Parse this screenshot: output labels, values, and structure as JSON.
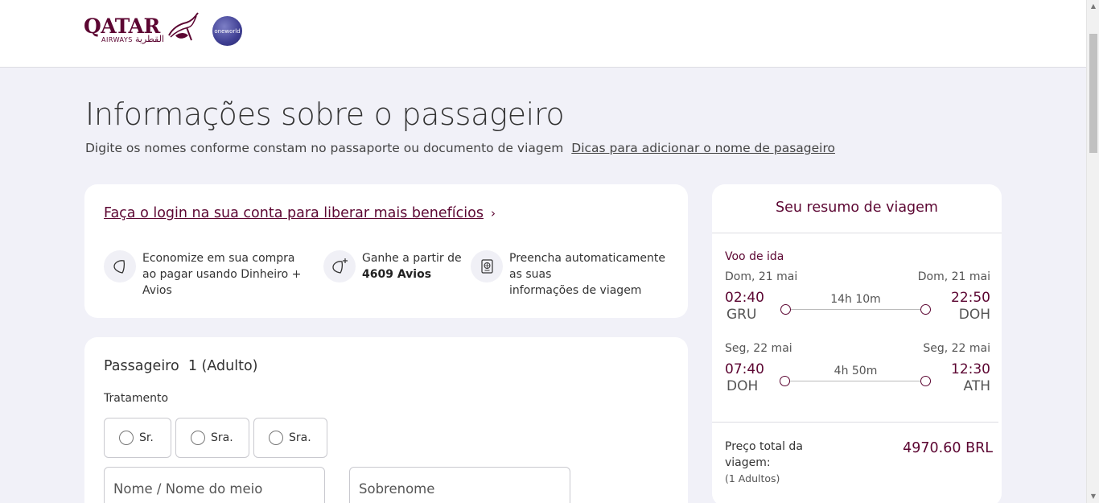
{
  "header": {
    "logo": {
      "wordmark": "QATAR",
      "subtitle": "AIRWAYS",
      "arabic": "القطرية"
    },
    "alliance_logo": "oneworld"
  },
  "page": {
    "title": "Informações sobre o passageiro",
    "subtitle": "Digite os nomes conforme constam no passaporte ou documento de viagem",
    "tips_link": "Dicas para adicionar o nome de pasageiro"
  },
  "login_card": {
    "link_label": "Faça o login na sua conta para liberar mais benefícios",
    "benefits": [
      {
        "icon": "avios-icon",
        "line1": "Economize em sua compra",
        "line2": "ao pagar usando Dinheiro +",
        "line3": "Avios"
      },
      {
        "icon": "avios-plus-icon",
        "line1": "Ganhe a partir de",
        "bold": "4609 Avios"
      },
      {
        "icon": "passport-icon",
        "line1": "Preencha automaticamente",
        "line2": "as suas",
        "line3": "informações de viagem"
      }
    ]
  },
  "passenger": {
    "title": "Passageiro  1 (Adulto)",
    "treatment_label": "Tratamento",
    "options": [
      "Sr.",
      "Sra.",
      "Sra."
    ],
    "first_name_placeholder": "Nome / Nome do meio",
    "last_name_placeholder": "Sobrenome"
  },
  "summary": {
    "title": "Seu resumo de viagem",
    "outbound_label": "Voo de ida",
    "segments": [
      {
        "dep_date": "Dom, 21 mai",
        "arr_date": "Dom, 21 mai",
        "dep_time": "02:40",
        "arr_time": "22:50",
        "dep_code": "GRU",
        "arr_code": "DOH",
        "duration": "14h 10m"
      },
      {
        "dep_date": "Seg, 22 mai",
        "arr_date": "Seg, 22 mai",
        "dep_time": "07:40",
        "arr_time": "12:30",
        "dep_code": "DOH",
        "arr_code": "ATH",
        "duration": "4h 50m"
      }
    ],
    "total_label": "Preço total da viagem:",
    "total_note": "(1 Adultos)",
    "total_value": "4970.60 BRL"
  },
  "colors": {
    "brand": "#5c0632",
    "background": "#f1f1f8",
    "card": "#ffffff"
  }
}
